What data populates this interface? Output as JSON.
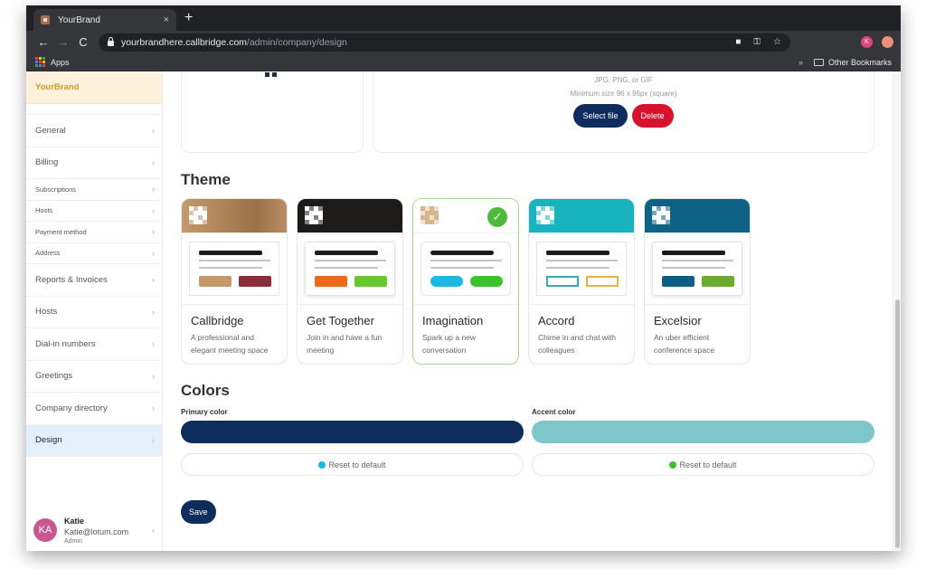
{
  "browser": {
    "tab_title": "YourBrand",
    "tab_close": "×",
    "new_tab": "+",
    "back": "←",
    "forward": "→",
    "reload": "C",
    "url_host": "yourbrandhere.callbridge.com",
    "url_path": "/admin/company/design",
    "camera_icon": "■",
    "key_icon": "⚿",
    "star_icon": "☆",
    "profile_initial": "K",
    "bookmarks_apps": "Apps",
    "bookmarks_more": "»",
    "other_bookmarks": "Other Bookmarks"
  },
  "sidebar": {
    "brand": "YourBrand",
    "chevron": "›",
    "items": [
      {
        "label": "General",
        "size": "big"
      },
      {
        "label": "Billing",
        "size": "big"
      },
      {
        "label": "Subscriptions",
        "size": "small"
      },
      {
        "label": "Hosts",
        "size": "small"
      },
      {
        "label": "Payment method",
        "size": "small"
      },
      {
        "label": "Address",
        "size": "small"
      },
      {
        "label": "Reports & Invoices",
        "size": "big"
      },
      {
        "label": "Hosts",
        "size": "big"
      },
      {
        "label": "Dial-in numbers",
        "size": "big"
      },
      {
        "label": "Greetings",
        "size": "big"
      },
      {
        "label": "Company directory",
        "size": "big"
      },
      {
        "label": "Design",
        "size": "big",
        "active": true
      }
    ],
    "user": {
      "initials": "KA",
      "name": "Katie",
      "email": "Katie@lotum.com",
      "role": "Admin"
    }
  },
  "logo_upload": {
    "formats": "JPG, PNG, or GIF",
    "min_size": "Minimum size 96 x 96px (square)",
    "select_label": "Select file",
    "delete_label": "Delete"
  },
  "theme": {
    "title": "Theme",
    "selected": "Imagination",
    "check_icon": "✓",
    "cards": [
      {
        "name": "Callbridge",
        "description": "A professional and elegant meeting space",
        "header_color": "#b08a62",
        "button_colors": [
          "#c49a6c",
          "#8b2e3a"
        ],
        "style": "square"
      },
      {
        "name": "Get Together",
        "description": "Join in and have a fun meeting",
        "header_color": "#1d1a1a",
        "button_colors": [
          "#ec6a1c",
          "#68c832"
        ],
        "style": "shadow"
      },
      {
        "name": "Imagination",
        "description": "Spark up a new conversation",
        "header_color": "#ffffff",
        "button_colors": [
          "#1cb8e0",
          "#3ec22c"
        ],
        "style": "round",
        "selected": true
      },
      {
        "name": "Accord",
        "description": "Chime in and chat with colleagues",
        "header_color": "#17b3be",
        "button_colors": [
          "#3aa8b8",
          "#e4b444"
        ],
        "style": "outline"
      },
      {
        "name": "Excelsior",
        "description": "An uber efficient conference space",
        "header_color": "#0d6285",
        "button_colors": [
          "#0f5f85",
          "#6aaa2e"
        ],
        "style": "shadow"
      }
    ]
  },
  "colors": {
    "title": "Colors",
    "primary": {
      "label": "Primary color",
      "value": "#0d2e5c",
      "reset_label": "Reset to default",
      "default_dot": "#1cb8e0"
    },
    "accent": {
      "label": "Accent color",
      "value": "#7ec6cb",
      "reset_label": "Reset to default",
      "default_dot": "#3ec22c"
    }
  },
  "save_label": "Save"
}
